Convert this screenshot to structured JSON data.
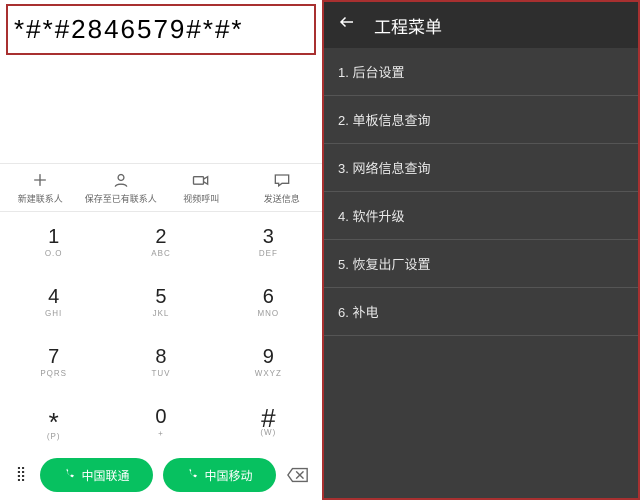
{
  "dialer": {
    "entered": "*#*#2846579#*#*",
    "actions": [
      {
        "name": "new-contact",
        "label": "新建联系人"
      },
      {
        "name": "save-existing",
        "label": "保存至已有联系人"
      },
      {
        "name": "video-call",
        "label": "视频呼叫"
      },
      {
        "name": "send-message",
        "label": "发送信息"
      }
    ],
    "keys": [
      {
        "main": "1",
        "sub": "O.O"
      },
      {
        "main": "2",
        "sub": "ABC"
      },
      {
        "main": "3",
        "sub": "DEF"
      },
      {
        "main": "4",
        "sub": "GHI"
      },
      {
        "main": "5",
        "sub": "JKL"
      },
      {
        "main": "6",
        "sub": "MNO"
      },
      {
        "main": "7",
        "sub": "PQRS"
      },
      {
        "main": "8",
        "sub": "TUV"
      },
      {
        "main": "9",
        "sub": "WXYZ"
      },
      {
        "main": "*",
        "sub": "(P)"
      },
      {
        "main": "0",
        "sub": "+"
      },
      {
        "main": "#",
        "sub": "(W)"
      }
    ],
    "sim1": "中国联通",
    "sim2": "中国移动"
  },
  "engineering": {
    "title": "工程菜单",
    "items": [
      "1. 后台设置",
      "2. 单板信息查询",
      "3. 网络信息查询",
      "4. 软件升级",
      "5. 恢复出厂设置",
      "6. 补电"
    ]
  }
}
